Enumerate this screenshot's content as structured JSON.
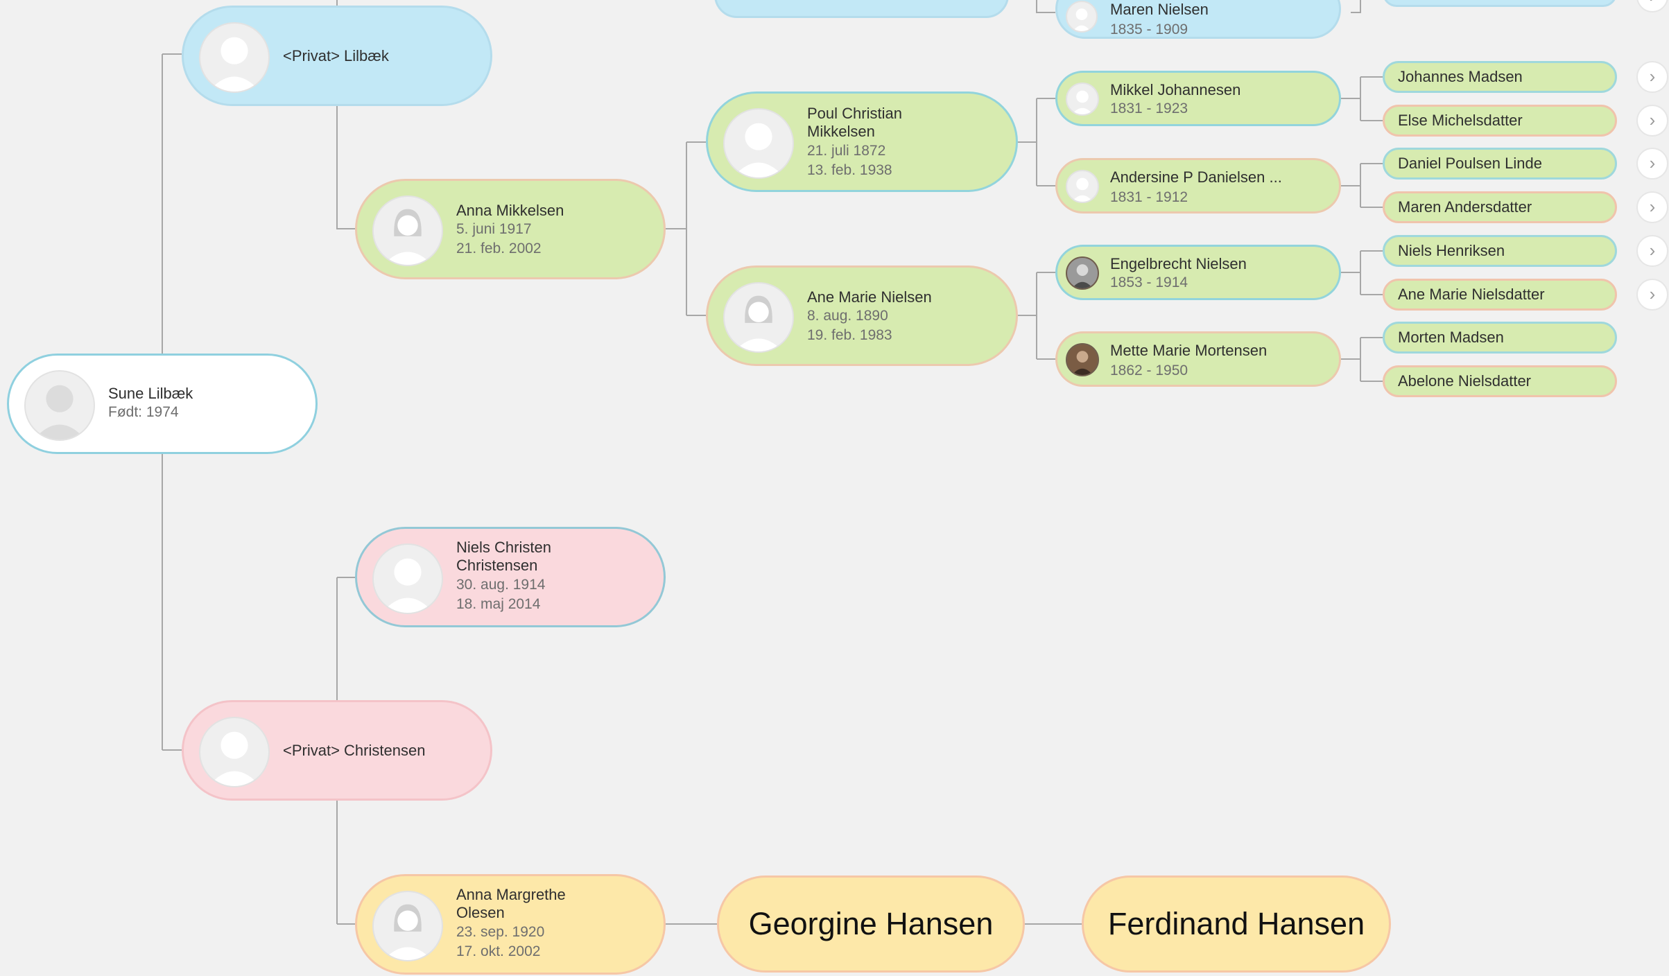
{
  "root": {
    "name": "Sune Lilbæk",
    "born": "Født: 1974"
  },
  "father": {
    "name": "<Privat> Lilbæk"
  },
  "mother": {
    "name": "<Privat> Christensen"
  },
  "father_mother": {
    "name": "Anna Mikkelsen",
    "birth": "5. juni 1917",
    "death": "21. feb. 2002"
  },
  "mother_father": {
    "name_line1": "Niels Christen",
    "name_line2": "Christensen",
    "birth": "30. aug. 1914",
    "death": "18. maj 2014"
  },
  "mother_mother": {
    "name_line1": "Anna Margrethe",
    "name_line2": "Olesen",
    "birth": "23. sep. 1920",
    "death": "17. okt. 2002"
  },
  "gen3": {
    "poul": {
      "name_line1": "Poul Christian",
      "name_line2": "Mikkelsen",
      "birth": "21. juli 1872",
      "death": "13. feb. 1938"
    },
    "ane": {
      "name": "Ane Marie Nielsen",
      "birth": "8. aug. 1890",
      "death": "19. feb. 1983"
    }
  },
  "gen4": {
    "maren_top": {
      "name": "Maren Nielsen",
      "years": "1835 - 1909"
    },
    "mikkel": {
      "name": "Mikkel Johannesen",
      "years": "1831 - 1923"
    },
    "andersine": {
      "name": "Andersine P Danielsen ...",
      "years": "1831 - 1912"
    },
    "engelbrecht": {
      "name": "Engelbrecht Nielsen",
      "years": "1853 - 1914"
    },
    "mette": {
      "name": "Mette Marie Mortensen",
      "years": "1862 - 1950"
    }
  },
  "gen5": [
    "Johannes Madsen",
    "Else Michelsdatter",
    "Daniel Poulsen Linde",
    "Maren Andersdatter",
    "Niels Henriksen",
    "Ane Marie Nielsdatter",
    "Morten Madsen",
    "Abelone Nielsdatter"
  ],
  "expand_icon": "›",
  "annotations": {
    "georgine": "Georgine Hansen",
    "ferdinand": "Ferdinand Hansen"
  },
  "colors": {
    "male_blue": "#c2e8f6",
    "green_line": "#d7ebb0",
    "female_pink": "#fad9dd",
    "annotation_yellow": "#fde8a9"
  }
}
